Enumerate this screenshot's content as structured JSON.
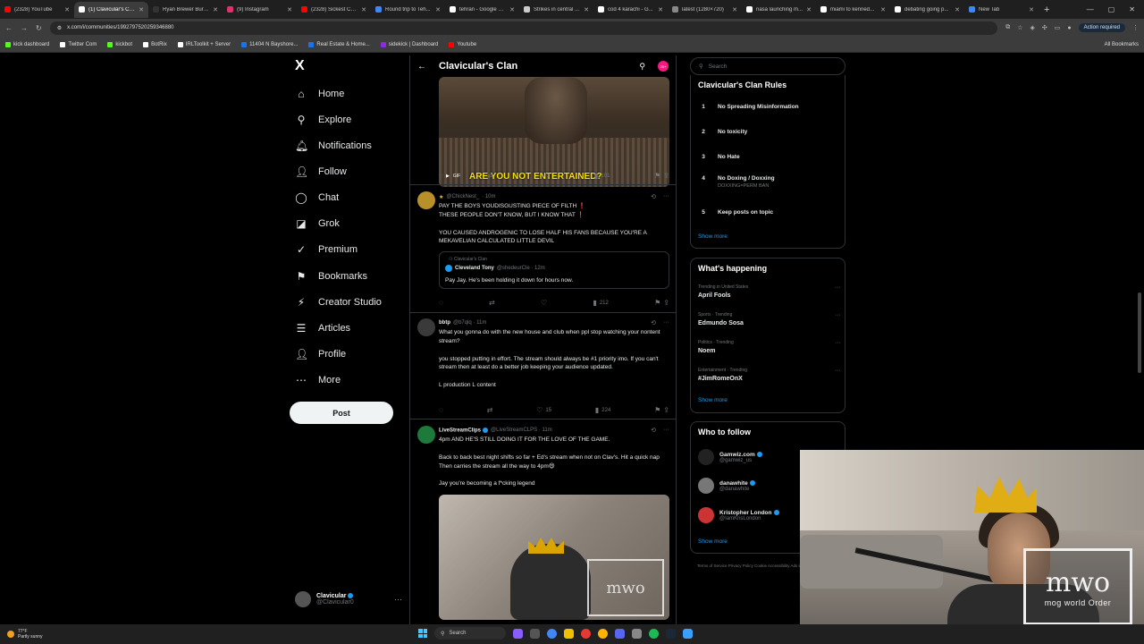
{
  "browser": {
    "tabs": [
      {
        "title": "(2328) YouTube",
        "color": "#ff0000",
        "active": false
      },
      {
        "title": "(1) Clavicular's Clan",
        "color": "#ffffff",
        "active": true
      },
      {
        "title": "Ryan Brewer Burg...",
        "color": "#333333",
        "active": false
      },
      {
        "title": "(9) Instagram",
        "color": "#e1306c",
        "active": false
      },
      {
        "title": "(2328) Sickest Co...",
        "color": "#ff0000",
        "active": false
      },
      {
        "title": "Round trip to Teh...",
        "color": "#4285f4",
        "active": false
      },
      {
        "title": "tehran - Google S...",
        "color": "#ffffff",
        "active": false
      },
      {
        "title": "Strikes in central ...",
        "color": "#cccccc",
        "active": false
      },
      {
        "title": "cod 4 karachi - G...",
        "color": "#ffffff",
        "active": false
      },
      {
        "title": "latest (1280×720)",
        "color": "#888888",
        "active": false
      },
      {
        "title": "nasa launching m...",
        "color": "#ffffff",
        "active": false
      },
      {
        "title": "miami to kenned...",
        "color": "#ffffff",
        "active": false
      },
      {
        "title": "debating going p...",
        "color": "#ffffff",
        "active": false
      },
      {
        "title": "New Tab",
        "color": "#4285f4",
        "active": false
      }
    ],
    "url": "x.com/i/communities/1992797520259346880",
    "action_required": "Action required",
    "bookmarks": [
      {
        "label": "kick dashboard",
        "color": "#53fc18"
      },
      {
        "label": "Twitter Com",
        "color": "#ffffff"
      },
      {
        "label": "kickbot",
        "color": "#53fc18"
      },
      {
        "label": "BotRix",
        "color": "#ffffff"
      },
      {
        "label": "IRLToolkit + Server",
        "color": "#ffffff"
      },
      {
        "label": "11404 N Bayshore...",
        "color": "#1a73e8"
      },
      {
        "label": "Real Estate & Home...",
        "color": "#1a73e8"
      },
      {
        "label": "sidekick | Dashboard",
        "color": "#8a2be2"
      },
      {
        "label": "Youtube",
        "color": "#ff0000"
      }
    ],
    "all_bookmarks": "All Bookmarks"
  },
  "nav": {
    "logo": "X",
    "items": [
      {
        "label": "Home",
        "icon": "⌂"
      },
      {
        "label": "Explore",
        "icon": "⚲"
      },
      {
        "label": "Notifications",
        "icon": "🔔︎"
      },
      {
        "label": "Follow",
        "icon": "👤︎"
      },
      {
        "label": "Chat",
        "icon": "◯"
      },
      {
        "label": "Grok",
        "icon": "◪"
      },
      {
        "label": "Premium",
        "icon": "✓"
      },
      {
        "label": "Bookmarks",
        "icon": "⚑"
      },
      {
        "label": "Creator Studio",
        "icon": "⚡"
      },
      {
        "label": "Articles",
        "icon": "☰"
      },
      {
        "label": "Profile",
        "icon": "👤︎"
      },
      {
        "label": "More",
        "icon": "⋯"
      }
    ],
    "post_label": "Post",
    "profile_name": "Clavicular",
    "profile_handle": "@Clavicular0"
  },
  "feed": {
    "title": "Clavicular's Clan",
    "badge": "20+",
    "media1_caption": "ARE YOU NOT ENTERTAINED?",
    "media1_gif": "GIF",
    "post1_actions": {
      "reply": "",
      "repost": "",
      "like": "3",
      "views": "101"
    },
    "post2": {
      "name": "@ChickNest_",
      "time": "· 10m",
      "text1": "PAY THE BOYS YOUDISGUSTING PIECE OF FILTH ❗",
      "text2": "THESE PEOPLE DON'T KNOW, BUT I KNOW THAT ❗",
      "text3": "YOU CAUSED ANDROGENIC TO LOSE HALF HIS FANS BECAUSE YOU'RE A MEKAVELIAN CALCULATED LITTLE DEVIL",
      "quote_community": "Clavicular's Clan",
      "quote_name": "Cleveland Tony",
      "quote_handle": "@shedeurCle · 12m",
      "quote_text": "Pay Jay. He's been holding it down for hours now.",
      "views": "212"
    },
    "post3": {
      "name": "bbtp",
      "handle": "@b7qlq · 11m",
      "text1": "What you gonna do with the new house and club when ppl stop watching your nontent stream?",
      "text2": "you stopped putting in effort. The stream should always be #1 priority imo. If you can't stream then at least do a better job keeping your audience updated.",
      "text3": "L production L content",
      "likes": "15",
      "views": "224"
    },
    "post4": {
      "name": "LiveStreamClips",
      "handle": "@LiveStreamCLPS · 11m",
      "text1": "4pm AND HE'S STILL DOING IT FOR THE LOVE OF THE GAME.",
      "text2": "Back to back best night shifts so far + Ed's stream when not on Clav's. Hit a quick nap Then carries the stream all the way to 4pm😄",
      "text3": "Jay you're becoming a f*cking legend",
      "watermark": "mwo"
    }
  },
  "sidebar": {
    "search_placeholder": "Search",
    "rules_title": "Clavicular's Clan Rules",
    "rules": [
      {
        "n": "1",
        "text": "No Spreading Misinformation",
        "sub": ""
      },
      {
        "n": "2",
        "text": "No toxicity",
        "sub": ""
      },
      {
        "n": "3",
        "text": "No Hate",
        "sub": ""
      },
      {
        "n": "4",
        "text": "No Doxing / Doxxing",
        "sub": "DOXXING=PERM BAN"
      },
      {
        "n": "5",
        "text": "Keep posts on topic",
        "sub": ""
      }
    ],
    "show_more": "Show more",
    "happening_title": "What's happening",
    "trends": [
      {
        "cat": "Trending in United States",
        "name": "April Fools"
      },
      {
        "cat": "Sports · Trending",
        "name": "Edmundo Sosa"
      },
      {
        "cat": "Politics · Trending",
        "name": "Noem"
      },
      {
        "cat": "Entertainment · Trending",
        "name": "#JimRomeOnX"
      }
    ],
    "wtf_title": "Who to follow",
    "accounts": [
      {
        "name": "Gamwiz.com",
        "handle": "@gamwiz_us",
        "color": "#222222"
      },
      {
        "name": "danawhite",
        "handle": "@danawhite",
        "color": "#777777"
      },
      {
        "name": "Kristopher London",
        "handle": "@IamKrisLondon",
        "color": "#cc3333"
      }
    ],
    "footer": "Terms of Service   Privacy Policy   Cookie   Accessibility   Ads info   More ···   © 20"
  },
  "webcam": {
    "logo_text": "mwo",
    "logo_sub": "mog world Order"
  },
  "taskbar": {
    "temp": "77°F",
    "weather": "Partly sunny",
    "search": "Search"
  }
}
